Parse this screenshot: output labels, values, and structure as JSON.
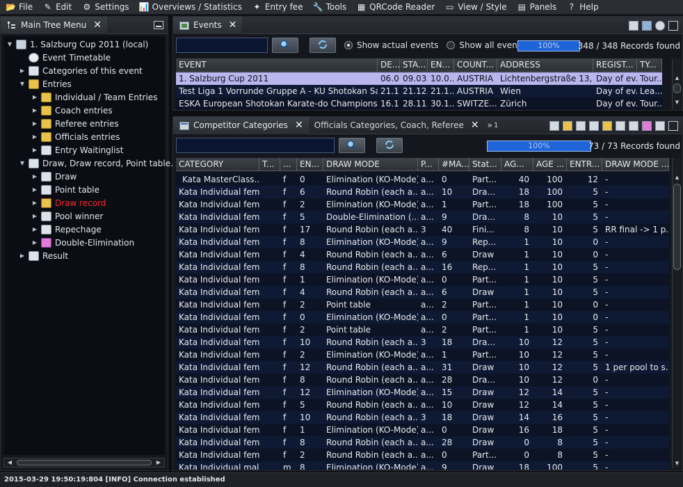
{
  "menu": [
    {
      "label": "File",
      "icon": "folder-icon"
    },
    {
      "label": "Edit",
      "icon": "pencil-icon"
    },
    {
      "label": "Settings",
      "icon": "gear-icon"
    },
    {
      "label": "Overviews / Statistics",
      "icon": "chart-icon"
    },
    {
      "label": "Entry fee",
      "icon": "money-icon"
    },
    {
      "label": "Tools",
      "icon": "wrench-icon"
    },
    {
      "label": "QRCode Reader",
      "icon": "qrcode-icon"
    },
    {
      "label": "View / Style",
      "icon": "monitor-icon"
    },
    {
      "label": "Panels",
      "icon": "panels-icon"
    },
    {
      "label": "Help",
      "icon": "help-icon"
    }
  ],
  "main_tree": {
    "title": "Main Tree Menu",
    "items": [
      {
        "label": "1. Salzburg Cup 2011 (local)",
        "level": 0,
        "icon": "event-icon",
        "expanded": true
      },
      {
        "label": "Event Timetable",
        "level": 1,
        "icon": "clock-icon",
        "leaf": true
      },
      {
        "label": "Categories of this event",
        "level": 1,
        "icon": "categories-icon"
      },
      {
        "label": "Entries",
        "level": 1,
        "icon": "folder-icon",
        "expanded": true
      },
      {
        "label": "Individual / Team Entries",
        "level": 2,
        "icon": "folder-icon"
      },
      {
        "label": "Coach entries",
        "level": 2,
        "icon": "folder-icon"
      },
      {
        "label": "Referee entries",
        "level": 2,
        "icon": "folder-icon"
      },
      {
        "label": "Officials entries",
        "level": 2,
        "icon": "folder-icon"
      },
      {
        "label": "Entry Waitinglist",
        "level": 2,
        "icon": "waitinglist-icon"
      },
      {
        "label": "Draw, Draw record, Point table...",
        "level": 1,
        "icon": "list-icon",
        "expanded": true
      },
      {
        "label": "Draw",
        "level": 2,
        "icon": "list-icon"
      },
      {
        "label": "Point table",
        "level": 2,
        "icon": "list-icon"
      },
      {
        "label": "Draw record",
        "level": 2,
        "icon": "draw-record-icon",
        "highlight": true
      },
      {
        "label": "Pool winner",
        "level": 2,
        "icon": "grid-icon"
      },
      {
        "label": "Repechage",
        "level": 2,
        "icon": "list-icon"
      },
      {
        "label": "Double-Elimination",
        "level": 2,
        "icon": "pink-icon"
      },
      {
        "label": "Result",
        "level": 1,
        "icon": "result-icon"
      }
    ]
  },
  "events": {
    "tab_label": "Events",
    "radio_actual": "Show actual events",
    "radio_all": "Show all events",
    "progress_label": "100%",
    "progress_value": 1.0,
    "records": "348 / 348 Records found",
    "columns": [
      "EVENT",
      "DE...",
      "STA...",
      "EN...",
      "COUNT...",
      "ADDRESS",
      "REGIST...",
      "TY..."
    ],
    "rows": [
      [
        "1. Salzburg Cup 2011",
        "06.0...",
        "09.03...",
        "10.0...",
        "AUSTRIA",
        "Lichtenbergstraße 13, ...",
        "Day of ev...",
        "Tour..."
      ],
      [
        "Test Liga 1 Vorrunde Gruppe A - KU Shotokan Salz...",
        "21.1...",
        "21.12...",
        "21.1...",
        "AUSTRIA",
        "Wien",
        "Day of ev...",
        "Lea..."
      ],
      [
        "ESKA European Shotokan Karate-do Championshi...",
        "16.1...",
        "28.11...",
        "30.1...",
        "SWITZE...",
        "Zürich",
        "Day of ev...",
        "Tour..."
      ]
    ]
  },
  "categories": {
    "tab_label": "Competitor Categories",
    "tab2_label": "Officials Categories, Coach, Referee",
    "overflow_label": "1",
    "progress_label": "100%",
    "progress_value": 1.0,
    "records": "73 / 73 Records found",
    "columns": [
      "CATEGORY",
      "T...",
      "...",
      "EN...",
      "DRAW MODE",
      "P...",
      "#MA...",
      "Stat...",
      "AG...",
      "AGE ...",
      "ENTR...",
      "DRAW MODE ..."
    ],
    "rows": [
      [
        "Kata MasterClass...",
        "",
        "f",
        "0",
        "Elimination (KO-Mode)",
        "a...",
        "0",
        "Part...",
        "40",
        "100",
        "12",
        "-"
      ],
      [
        "Kata Individual fem...",
        "",
        "f",
        "6",
        "Round Robin (each a...",
        "a...",
        "10",
        "Dra...",
        "18",
        "100",
        "5",
        "-"
      ],
      [
        "Kata Individual fem...",
        "",
        "f",
        "2",
        "Elimination (KO-Mode)",
        "a...",
        "1",
        "Part...",
        "18",
        "100",
        "5",
        "-"
      ],
      [
        "Kata Individual fem...",
        "",
        "f",
        "5",
        "Double-Elimination (...",
        "a...",
        "9",
        "Dra...",
        "8",
        "10",
        "5",
        "-"
      ],
      [
        "Kata Individual fem...",
        "",
        "f",
        "17",
        "Round Robin (each a...",
        "3",
        "40",
        "Fini...",
        "8",
        "10",
        "5",
        "RR final -> 1 p..."
      ],
      [
        "Kata Individual fem...",
        "",
        "f",
        "8",
        "Elimination (KO-Mode)",
        "a...",
        "9",
        "Rep...",
        "1",
        "10",
        "0",
        "-"
      ],
      [
        "Kata Individual fem...",
        "",
        "f",
        "4",
        "Round Robin (each a...",
        "a...",
        "6",
        "Draw",
        "1",
        "10",
        "0",
        "-"
      ],
      [
        "Kata Individual fem...",
        "",
        "f",
        "8",
        "Round Robin (each a...",
        "a...",
        "16",
        "Rep...",
        "1",
        "10",
        "5",
        "-"
      ],
      [
        "Kata Individual fem...",
        "",
        "f",
        "1",
        "Elimination (KO-Mode)",
        "a...",
        "0",
        "Part...",
        "1",
        "10",
        "5",
        "-"
      ],
      [
        "Kata Individual fem...",
        "",
        "f",
        "4",
        "Round Robin (each a...",
        "a...",
        "6",
        "Draw",
        "1",
        "10",
        "5",
        "-"
      ],
      [
        "Kata Individual fem...",
        "",
        "f",
        "2",
        "Point table",
        "a...",
        "2",
        "Part...",
        "1",
        "10",
        "0",
        "-"
      ],
      [
        "Kata Individual fem...",
        "",
        "f",
        "0",
        "Elimination (KO-Mode)",
        "a...",
        "0",
        "Part...",
        "1",
        "10",
        "0",
        "-"
      ],
      [
        "Kata Individual fem...",
        "",
        "f",
        "2",
        "Point table",
        "a...",
        "2",
        "Part...",
        "1",
        "10",
        "5",
        "-"
      ],
      [
        "Kata Individual fem...",
        "",
        "f",
        "10",
        "Round Robin (each a...",
        "3",
        "18",
        "Dra...",
        "10",
        "12",
        "5",
        "-"
      ],
      [
        "Kata Individual fem...",
        "",
        "f",
        "2",
        "Elimination (KO-Mode)",
        "a...",
        "1",
        "Part...",
        "10",
        "12",
        "5",
        "-"
      ],
      [
        "Kata Individual fem...",
        "",
        "f",
        "12",
        "Round Robin (each a...",
        "a...",
        "31",
        "Draw",
        "10",
        "12",
        "5",
        "1 per pool to s..."
      ],
      [
        "Kata Individual fem...",
        "",
        "f",
        "8",
        "Round Robin (each a...",
        "a...",
        "28",
        "Dra...",
        "10",
        "12",
        "0",
        "-"
      ],
      [
        "Kata Individual fem...",
        "",
        "f",
        "12",
        "Elimination (KO-Mode)",
        "a...",
        "15",
        "Draw",
        "12",
        "14",
        "5",
        "-"
      ],
      [
        "Kata Individual fem...",
        "",
        "f",
        "5",
        "Round Robin (each a...",
        "a...",
        "10",
        "Draw",
        "12",
        "14",
        "5",
        "-"
      ],
      [
        "Kata Individual fem...",
        "",
        "f",
        "10",
        "Round Robin (each a...",
        "3",
        "18",
        "Draw",
        "14",
        "16",
        "5",
        "-"
      ],
      [
        "Kata Individual fem...",
        "",
        "f",
        "1",
        "Elimination (KO-Mode)",
        "a...",
        "0",
        "Draw",
        "16",
        "18",
        "5",
        "-"
      ],
      [
        "Kata Individual fem...",
        "",
        "f",
        "8",
        "Round Robin (each a...",
        "a...",
        "28",
        "Draw",
        "0",
        "8",
        "5",
        "-"
      ],
      [
        "Kata Individual fem...",
        "",
        "f",
        "2",
        "Round Robin (each a...",
        "a...",
        "0",
        "Part...",
        "0",
        "8",
        "5",
        "-"
      ],
      [
        "Kata Individual mal...",
        "",
        "m",
        "8",
        "Elimination (KO-Mode)",
        "a...",
        "9",
        "Draw",
        "18",
        "100",
        "5",
        "-"
      ]
    ]
  },
  "status_text": "2015-03-29 19:50:19:804 [INFO] Connection established"
}
